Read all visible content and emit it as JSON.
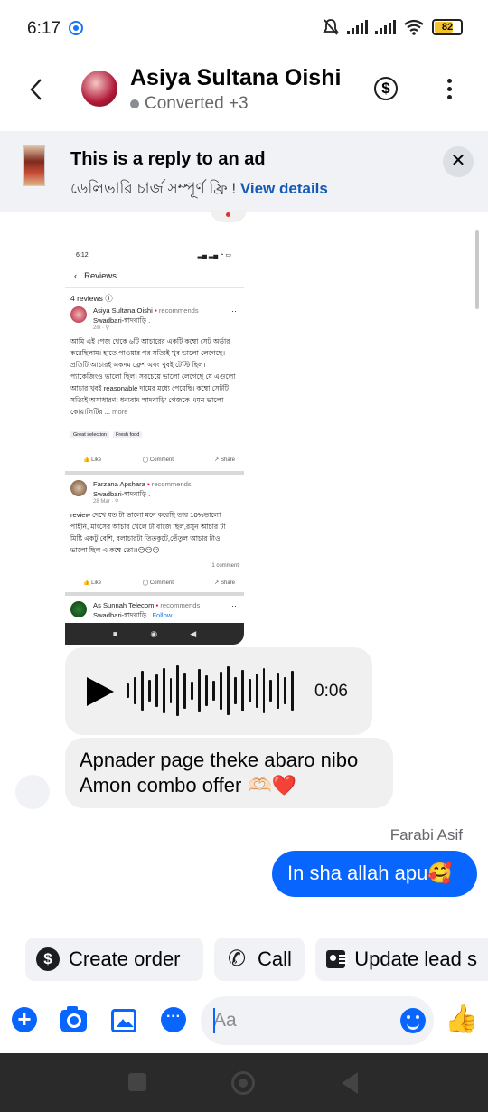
{
  "status": {
    "time": "6:17",
    "battery": "82"
  },
  "header": {
    "name": "Asiya Sultana Oishi",
    "status": "Converted +3"
  },
  "banner": {
    "title": "This is a reply to an ad",
    "subtitle": "ডেলিভারি চার্জ সম্পূর্ণ ফ্রি ! ",
    "link": "View details"
  },
  "shared_image": {
    "status_time": "6:12",
    "page_title": "Reviews",
    "count_label": "4 reviews",
    "reviews": [
      {
        "name": "Asiya Sultana Oishi",
        "recommends": "recommends",
        "page": "Swadbari-স্বাদবাড়ি .",
        "date": "2m",
        "body": "আমি এই পেজ থেকে ৬টি আচারের একটি কম্বো সেট অর্ডার করেছিলাম। হাতে পাওয়ার পর সত্যিই খুব ভালো লেগেছে। প্রতিটি আচারই একদম ফ্রেশ এবং খুবই টেস্টি ছিল। প্যাকেজিংও ভালো ছিল। সবচেয়ে ভালো লেগেছে যে এগুলো আচার খুবই reasonable দামের মধ্যে পেয়েছি। কম্বো সেটটি সত্যিই অসাধারণ। ধন্যবাদ 'স্বাদবাড়ি' পেজকে এমন ভালো কোয়ালিটির ...",
        "more": "more",
        "tags": [
          "Great selection",
          "Fresh food"
        ]
      },
      {
        "name": "Farzana Apshara",
        "recommends": "recommends",
        "page": "Swadbari-স্বাদবাড়ি .",
        "date": "28 Mar",
        "body": "review দেখে যত টা ভালো মনে করেছি তার 10%ভালো পাইনি, মাংসের আচার খেলে টা বাজে ছিল,রসুন আচার টা মিষ্টি একটু বেশি, বলাচারটা তিতকুটে,তেঁতুল আচার টাও ভালো ছিল এ কম্বে তো।।😑😑😑",
        "comments": "1 comment"
      },
      {
        "name": "As Sunnah Telecom",
        "recommends": "recommends",
        "page": "Swadbari-স্বাদবাড়ি .",
        "follow": "Follow"
      }
    ],
    "actions": {
      "like": "Like",
      "comment": "Comment",
      "share": "Share"
    }
  },
  "voice": {
    "duration": "0:06"
  },
  "messages": {
    "received_1": "Apnader page theke abaro nibo Amon combo offer 🫶🏻❤️",
    "sender_name": "Farabi Asif",
    "sent_1": "In sha allah apu🥰"
  },
  "quick_actions": {
    "create_order": "Create order",
    "call": "Call",
    "update_lead": "Update lead s"
  },
  "composer": {
    "placeholder": "Aa"
  },
  "icons": {
    "back": "back-arrow-icon",
    "dollar": "dollar-icon",
    "more": "more-vertical-icon",
    "close": "close-icon",
    "play": "play-icon",
    "plus": "plus-icon",
    "camera": "camera-icon",
    "gallery": "gallery-icon",
    "chat": "chat-icon",
    "emoji": "emoji-icon",
    "like": "thumbs-up-icon"
  },
  "colors": {
    "brand": "#0866ff",
    "bubble_gray": "#f0f0f0",
    "heart": "#e41e3f"
  }
}
